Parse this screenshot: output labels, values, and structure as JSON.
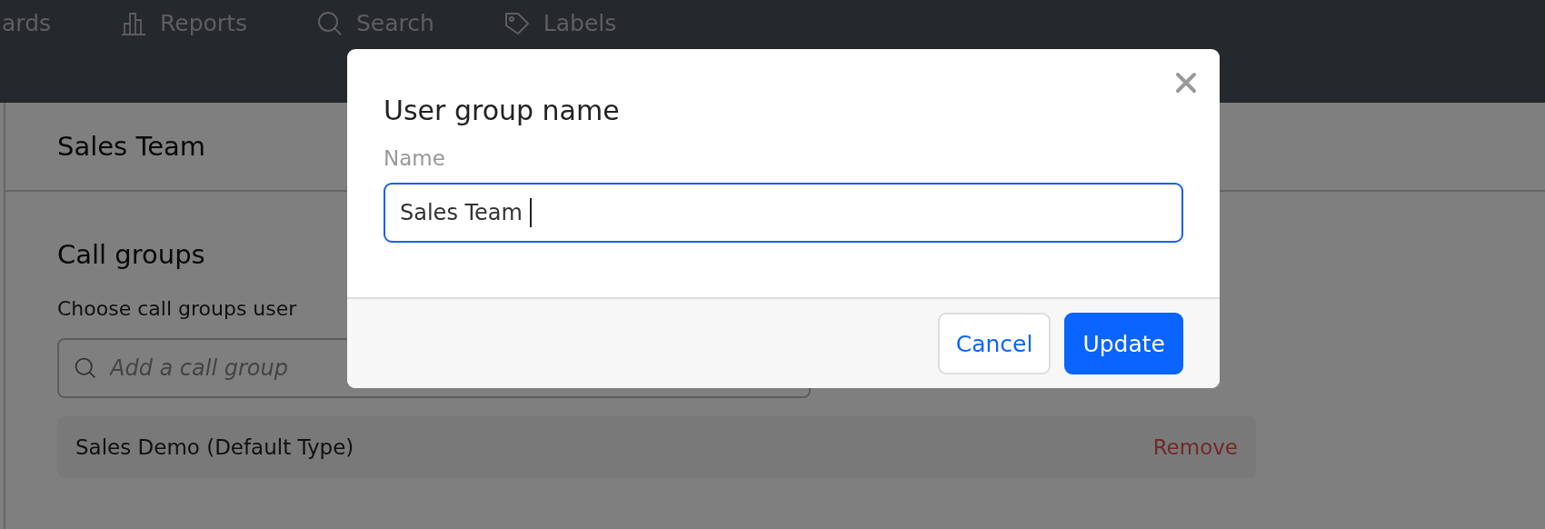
{
  "nav": {
    "items": [
      {
        "kind": "text",
        "label": "ards"
      },
      {
        "kind": "chart",
        "label": "Reports"
      },
      {
        "kind": "search",
        "label": "Search"
      },
      {
        "kind": "tag",
        "label": "Labels"
      }
    ]
  },
  "page": {
    "title": "Sales Team",
    "section_title": "Call groups",
    "section_description": "Choose call groups user",
    "search": {
      "placeholder": "Add a call group"
    },
    "call_groups": [
      {
        "name": "Sales Demo (Default Type)",
        "action": "Remove"
      }
    ]
  },
  "dialog": {
    "title": "User group name",
    "field_label": "Name",
    "value": "Sales Team",
    "buttons": [
      {
        "kind": "secondary",
        "label": "Cancel"
      },
      {
        "kind": "primary",
        "label": "Update"
      }
    ]
  }
}
